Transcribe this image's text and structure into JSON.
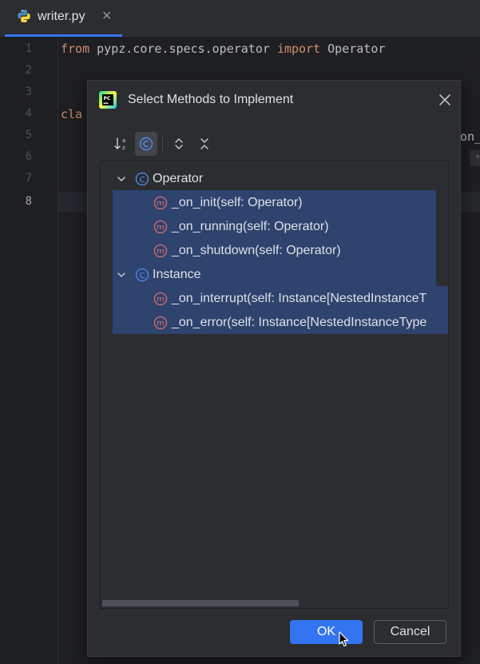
{
  "tab": {
    "file_name": "writer.py",
    "close_symbol": "✕",
    "icon": "python-icon"
  },
  "editor": {
    "line_numbers": [
      "1",
      "2",
      "3",
      "4",
      "5",
      "6",
      "7",
      "8"
    ],
    "current_line": "8",
    "line1": {
      "kw_from": "from",
      "module": " pypz.core.specs.operator ",
      "kw_import": "import",
      "name": " Operator"
    },
    "line4_visible": "cla",
    "line5_visible": "on_",
    "line6_visible": "*"
  },
  "dialog": {
    "title": "Select Methods to Implement",
    "logo": "pycharm-logo-icon",
    "toolbar": {
      "sort": "sort-alphabetically-icon",
      "group": "show-classes-icon",
      "expand": "expand-all-icon",
      "collapse": "collapse-all-icon"
    },
    "tree": [
      {
        "type": "class",
        "label": "Operator",
        "children": [
          {
            "label": "_on_init(self: Operator)"
          },
          {
            "label": "_on_running(self: Operator)"
          },
          {
            "label": "_on_shutdown(self: Operator)"
          }
        ]
      },
      {
        "type": "class",
        "label": "Instance",
        "children": [
          {
            "label": "_on_interrupt(self: Instance[NestedInstanceT"
          },
          {
            "label": "_on_error(self: Instance[NestedInstanceType"
          }
        ]
      }
    ],
    "class_icon_letter": "C",
    "method_icon_letter": "m",
    "ok_label": "OK",
    "cancel_label": "Cancel"
  },
  "colors": {
    "accent": "#3574f0",
    "selection": "#2e436e",
    "keyword": "#cf8e6d",
    "method_icon": "#e06c6c",
    "class_icon": "#548af7"
  }
}
